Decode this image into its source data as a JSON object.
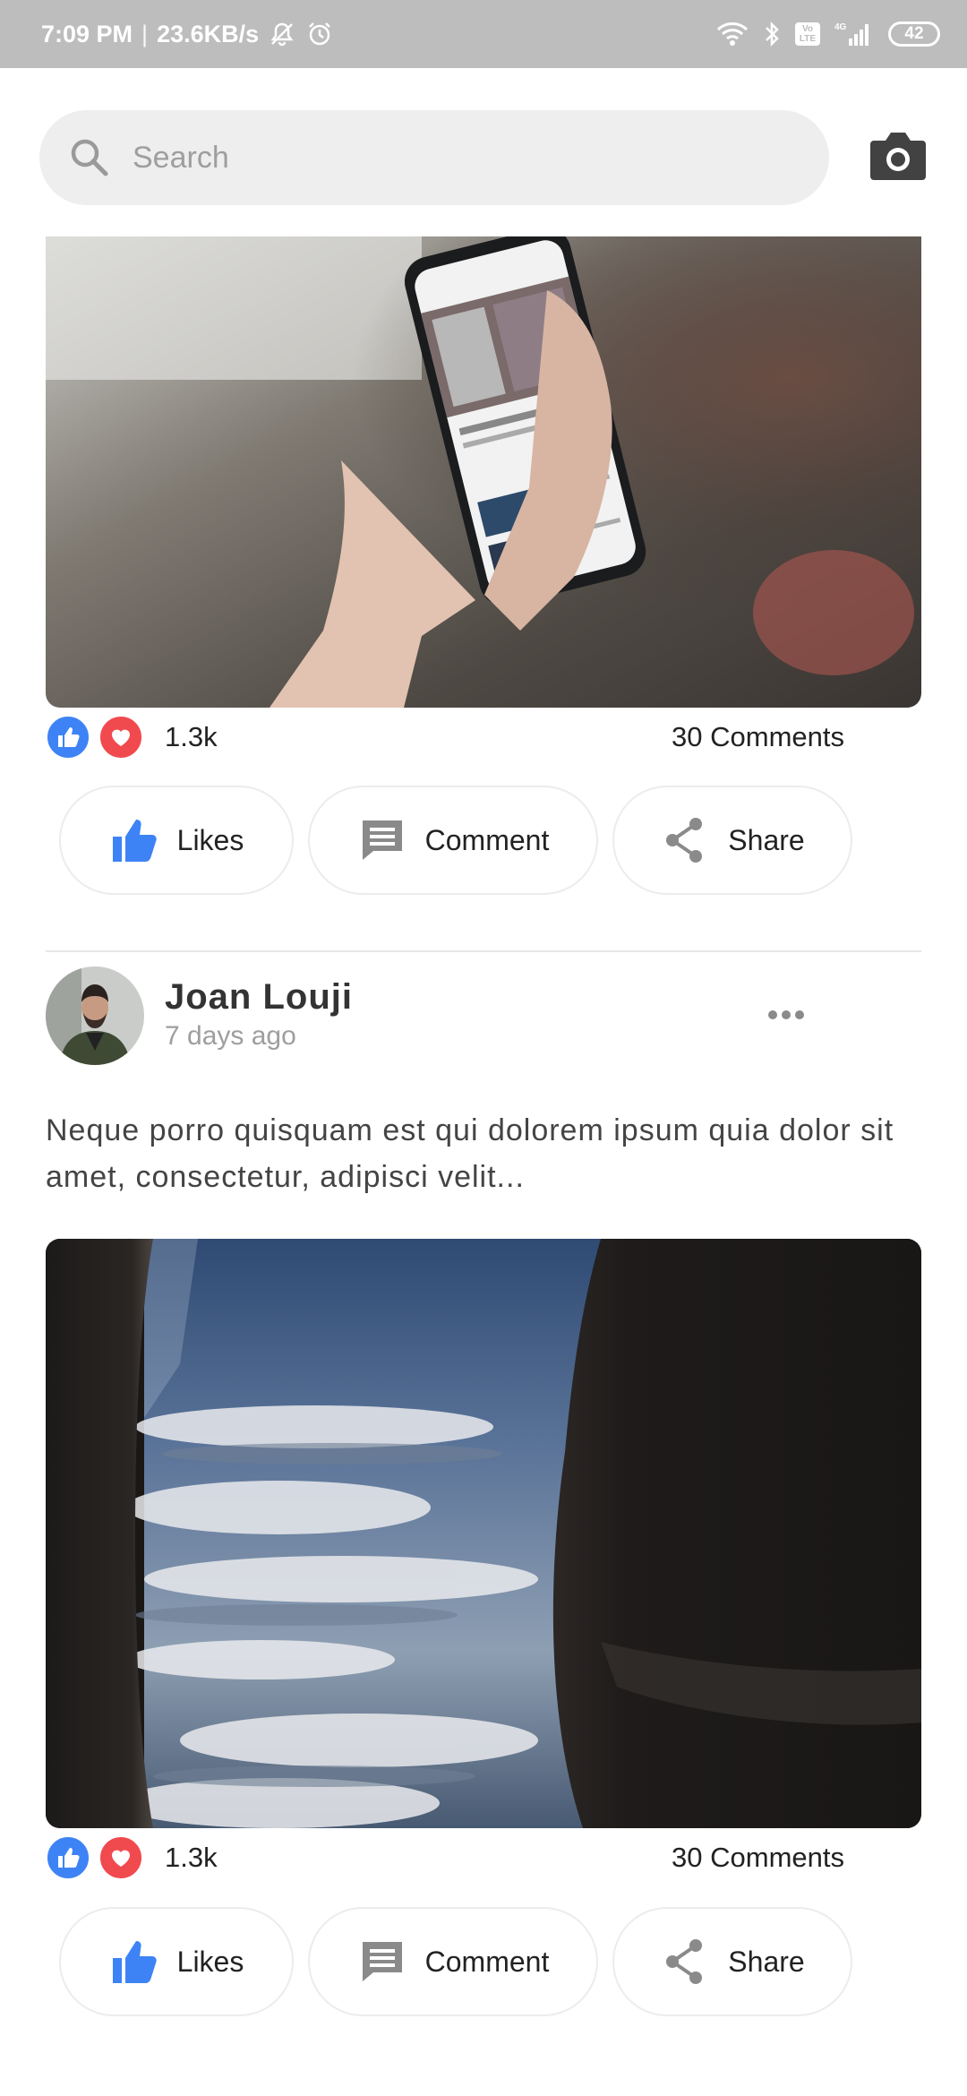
{
  "status_bar": {
    "time": "7:09 PM",
    "separator": "|",
    "speed": "23.6KB/s",
    "network": "4G",
    "volte_label": "Vo LTE",
    "battery": "42"
  },
  "search": {
    "placeholder": "Search"
  },
  "posts": [
    {
      "image_icon": "phone-video-photo",
      "reaction_count": "1.3k",
      "comments": "30 Comments",
      "actions": {
        "like": "Likes",
        "comment": "Comment",
        "share": "Share"
      }
    },
    {
      "author": "Joan Louji",
      "time_ago": "7 days ago",
      "text": "Neque porro quisquam est qui dolorem ipsum quia dolor sit amet, consectetur, adipisci velit...",
      "image_icon": "airplane-window-clouds-photo",
      "reaction_count": "1.3k",
      "comments": "30 Comments",
      "actions": {
        "like": "Likes",
        "comment": "Comment",
        "share": "Share"
      }
    }
  ],
  "colors": {
    "like_blue": "#3d83f5",
    "love_red": "#f04a4f",
    "status_bar": "#bdbdbd",
    "search_bg": "#eeeeee"
  }
}
